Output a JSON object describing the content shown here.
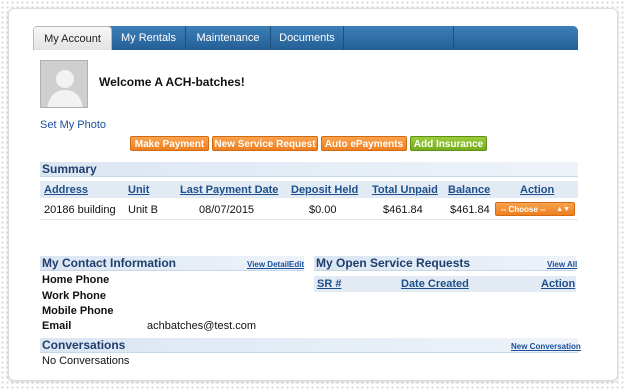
{
  "tabs": [
    {
      "label": "My Account"
    },
    {
      "label": "My Rentals"
    },
    {
      "label": "Maintenance"
    },
    {
      "label": "Documents"
    }
  ],
  "header": {
    "welcome": "Welcome A ACH-batches!",
    "set_photo": "Set My Photo"
  },
  "actions": {
    "make_payment": "Make Payment",
    "new_service_request": "New Service Request",
    "auto_epayments": "Auto ePayments",
    "add_insurance": "Add Insurance"
  },
  "summary": {
    "title": "Summary",
    "columns": [
      "Address",
      "Unit",
      "Last Payment Date",
      "Deposit Held",
      "Total Unpaid",
      "Balance",
      "Action"
    ],
    "rows": [
      {
        "address": "20186 building",
        "unit": "Unit B",
        "last_payment_date": "08/07/2015",
        "deposit_held": "$0.00",
        "total_unpaid": "$461.84",
        "balance": "$461.84",
        "action": "-- Choose --"
      }
    ]
  },
  "contact": {
    "title": "My Contact Information",
    "view_detail": "View Detail",
    "edit": "Edit",
    "fields": [
      {
        "label": "Home Phone",
        "value": ""
      },
      {
        "label": "Work Phone",
        "value": ""
      },
      {
        "label": "Mobile Phone",
        "value": ""
      },
      {
        "label": "Email",
        "value": "achbatches@test.com"
      }
    ]
  },
  "service_requests": {
    "title": "My Open Service Requests",
    "view_all": "View All",
    "columns": [
      "SR #",
      "Date Created",
      "Action"
    ]
  },
  "conversations": {
    "title": "Conversations",
    "new_link": "New Conversation",
    "empty_text": "No Conversations"
  },
  "colors": {
    "tab_blue": "#2d6ca6",
    "button_orange": "#f29a3d",
    "button_green": "#8bbf2a",
    "heading_blue": "#1e3f6e"
  }
}
